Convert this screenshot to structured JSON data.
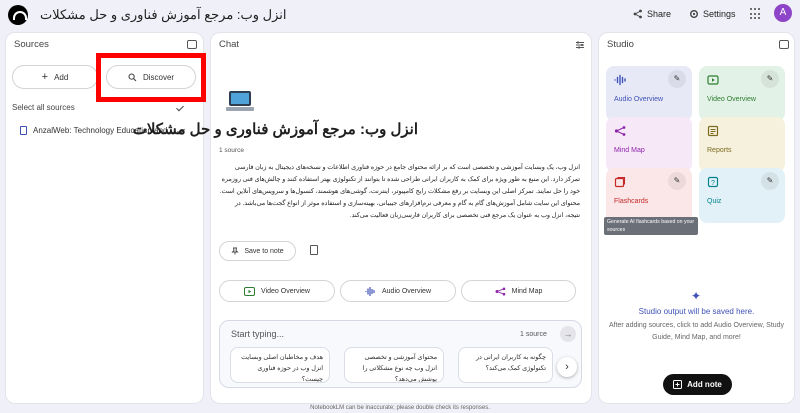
{
  "topbar": {
    "notebook_title": "انزل وب: مرجع آموزش فناوری و حل مشکلات",
    "share_label": "Share",
    "settings_label": "Settings",
    "avatar_initial": "A",
    "avatar_color": "#8e44c9"
  },
  "sources": {
    "title": "Sources",
    "add_label": "Add",
    "discover_label": "Discover",
    "select_all_label": "Select all sources",
    "items": [
      {
        "label": "AnzalWeb: Technology Education and...",
        "checked": true
      }
    ]
  },
  "chat": {
    "title": "Chat",
    "notebook_heading": "انزل وب: مرجع آموزش فناوری و حل مشکلات",
    "source_count": "1 source",
    "summary_lines": [
      "انزل وب، یک وبسایت آموزشی و تخصصی است که بر ارائه محتوای جامع در حوزه فناوری اطلاعات و نسخه‌های دیجیتال به زبان فارسی",
      "تمرکز دارد. این منبع به طور ویژه برای کمک به کاربران ایرانی طراحی شده تا بتوانند از تکنولوژی بهتر استفاده کنند و چالش‌های فنی روزمره",
      "خود را حل نمایند. تمرکز اصلی این وبسایت بر رفع مشکلات رایج کامپیوتر، اینترنت، گوشی‌های هوشمند، کنسول‌ها و سرویس‌های آنلاین است.",
      "محتوای این سایت شامل آموزش‌های گام به گام و معرفی نرم‌افزارهای جیبیانی، بهینه‌سازی و استفاده موثر از انواع گجت‌ها می‌باشد. در",
      "نتیجه، انزل وب به عنوان یک مرجع فنی تخصصی برای کاربران فارسی‌زبان فعالیت می‌کند."
    ],
    "save_note_label": "Save to note",
    "quick_actions": [
      "Video Overview",
      "Audio Overview",
      "Mind Map"
    ],
    "input_placeholder": "Start typing...",
    "input_source_count": "1 source",
    "suggestions": [
      "هدف و مخاطبان اصلی وبسایت انزل وب در حوزه فناوری چیست؟",
      "محتوای آموزشی و تخصصی انزل وب چه نوع مشکلاتی را پوشش می‌دهد؟",
      "چگونه به کاربران ایرانی در تکنولوژی کمک می‌کند؟"
    ]
  },
  "studio": {
    "title": "Studio",
    "tiles": [
      {
        "label": "Audio Overview",
        "bg": "#e7e9f7",
        "color": "#3f51b5",
        "icon": "audio-waveform-icon"
      },
      {
        "label": "Video Overview",
        "bg": "#e3f2e6",
        "color": "#2e7d32",
        "icon": "video-icon"
      },
      {
        "label": "Mind Map",
        "bg": "#f6e8f6",
        "color": "#8e24aa",
        "icon": "mind-map-icon"
      },
      {
        "label": "Reports",
        "bg": "#f6f1dd",
        "color": "#7a6a1e",
        "icon": "reports-icon"
      },
      {
        "label": "Flashcards",
        "bg": "#fbe7e7",
        "color": "#c62828",
        "icon": "flashcards-icon"
      },
      {
        "label": "Quiz",
        "bg": "#e2f1f7",
        "color": "#00838f",
        "icon": "quiz-icon"
      }
    ],
    "tooltip": "Generate AI flashcards based on your sources",
    "empty_title": "Studio output will be saved here.",
    "empty_sub": "After adding sources, click to add Audio Overview, Study Guide, Mind Map, and more!",
    "add_note_label": "Add note"
  },
  "disclaimer": "NotebookLM can be inaccurate; please double check its responses."
}
